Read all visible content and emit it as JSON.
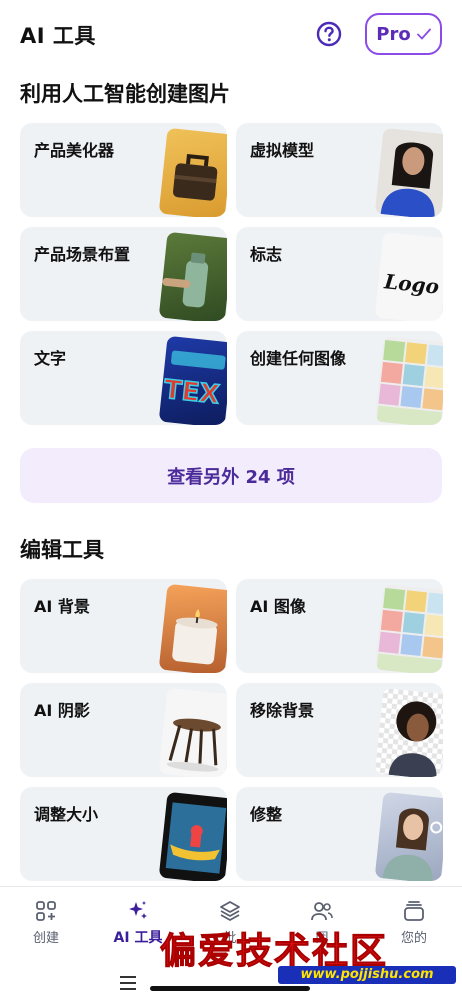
{
  "header": {
    "title": "AI 工具",
    "pro_label": "Pro"
  },
  "sections": {
    "create_title": "利用人工智能创建图片",
    "edit_title": "编辑工具"
  },
  "create_tools": [
    {
      "label": "产品美化器",
      "icon": "leather-bag-photo"
    },
    {
      "label": "虚拟模型",
      "icon": "woman-portrait-photo"
    },
    {
      "label": "产品场景布置",
      "icon": "water-bottle-photo"
    },
    {
      "label": "标志",
      "icon": "logo-sample"
    },
    {
      "label": "文字",
      "icon": "text-art-sample"
    },
    {
      "label": "创建任何图像",
      "icon": "image-collage"
    }
  ],
  "more_button": "查看另外 24 项",
  "edit_tools": [
    {
      "label": "AI 背景",
      "icon": "candle-photo"
    },
    {
      "label": "AI 图像",
      "icon": "image-collage"
    },
    {
      "label": "AI 阴影",
      "icon": "stool-photo"
    },
    {
      "label": "移除背景",
      "icon": "cutout-portrait"
    },
    {
      "label": "调整大小",
      "icon": "kayak-photo"
    },
    {
      "label": "修整",
      "icon": "retouch-portrait"
    }
  ],
  "nav": {
    "items": [
      {
        "label": "创建",
        "icon": "grid-plus-icon"
      },
      {
        "label": "AI 工具",
        "icon": "sparkles-icon",
        "active": true
      },
      {
        "label": "批",
        "icon": "layers-icon"
      },
      {
        "label": "团",
        "icon": "people-icon"
      },
      {
        "label": "您的",
        "icon": "folder-stack-icon"
      }
    ]
  },
  "watermark": {
    "title": "偏爱技术社区",
    "url": "www.pojjishu.com"
  },
  "thumb_text": {
    "logo": "Logo",
    "text_art": "TEX"
  },
  "colors": {
    "accent": "#8a4be8",
    "accent_dark": "#3c1e9a",
    "card_bg": "#eff2f5",
    "more_bg": "#f2ecfc"
  }
}
